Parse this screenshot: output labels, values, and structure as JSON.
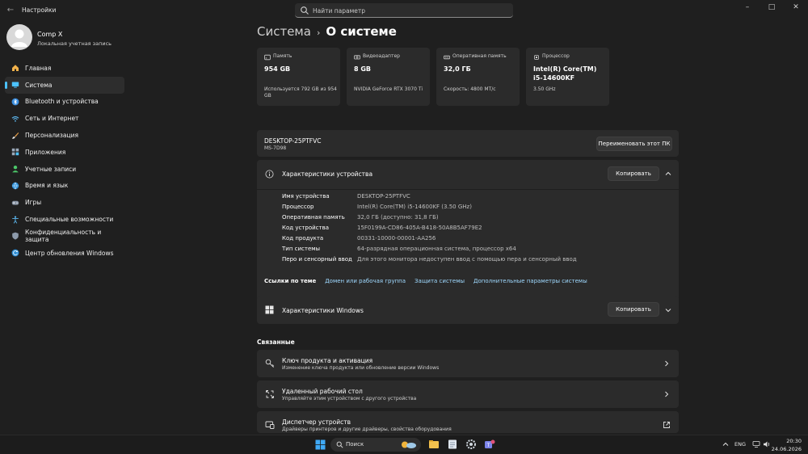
{
  "window": {
    "title": "Настройки",
    "search_placeholder": "Найти параметр",
    "minimize": "–",
    "maximize": "□",
    "close": "✕",
    "back": "←"
  },
  "profile": {
    "name": "Comp X",
    "subtitle": "Локальная учетная запись"
  },
  "sidebar": {
    "items": [
      {
        "label": "Главная",
        "icon": "home-icon"
      },
      {
        "label": "Система",
        "icon": "system-icon"
      },
      {
        "label": "Bluetooth и устройства",
        "icon": "bluetooth-icon"
      },
      {
        "label": "Сеть и Интернет",
        "icon": "wifi-icon"
      },
      {
        "label": "Персонализация",
        "icon": "brush-icon"
      },
      {
        "label": "Приложения",
        "icon": "apps-icon"
      },
      {
        "label": "Учетные записи",
        "icon": "accounts-icon"
      },
      {
        "label": "Время и язык",
        "icon": "globe-icon"
      },
      {
        "label": "Игры",
        "icon": "gamepad-icon"
      },
      {
        "label": "Специальные возможности",
        "icon": "accessibility-icon"
      },
      {
        "label": "Конфиденциальность и защита",
        "icon": "shield-icon"
      },
      {
        "label": "Центр обновления Windows",
        "icon": "update-icon"
      }
    ]
  },
  "breadcrumb": {
    "parent": "Система",
    "separator": "›",
    "current": "О системе"
  },
  "cards": [
    {
      "label": "Память",
      "value": "954 GB",
      "detail": "Используется 792 GB из 954 GB",
      "icon": "storage-icon"
    },
    {
      "label": "Видеоадаптер",
      "value": "8 GB",
      "detail": "NVIDIA GeForce RTX 3070 Ti",
      "icon": "gpu-icon"
    },
    {
      "label": "Оперативная память",
      "value": "32,0 ГБ",
      "detail": "Скорость: 4800 МТ/с",
      "icon": "ram-icon"
    },
    {
      "label": "Процессор",
      "value": "Intel(R) Core(TM) i5-14600KF",
      "detail": "3.50 GHz",
      "icon": "cpu-icon"
    }
  ],
  "device": {
    "name": "DESKTOP-25PTFVC",
    "model": "MS-7D98",
    "rename_label": "Переименовать этот ПК"
  },
  "device_specs": {
    "title": "Характеристики устройства",
    "copy_label": "Копировать",
    "rows": [
      {
        "label": "Имя устройства",
        "value": "DESKTOP-25PTFVC"
      },
      {
        "label": "Процессор",
        "value": "Intel(R) Core(TM) i5-14600KF (3.50 GHz)"
      },
      {
        "label": "Оперативная память",
        "value": "32,0 ГБ (доступно: 31,8 ГБ)"
      },
      {
        "label": "Код устройства",
        "value": "15F0199A-CD86-405A-B418-50A8B5AF79E2"
      },
      {
        "label": "Код продукта",
        "value": "00331-10000-00001-AA256"
      },
      {
        "label": "Тип системы",
        "value": "64-разрядная операционная система, процессор x64"
      },
      {
        "label": "Перо и сенсорный ввод",
        "value": "Для этого монитора недоступен ввод с помощью пера и сенсорный ввод"
      }
    ],
    "links_label": "Ссылки по теме",
    "links": [
      "Домен или рабочая группа",
      "Защита системы",
      "Дополнительные параметры системы"
    ]
  },
  "windows_specs": {
    "title": "Характеристики Windows",
    "copy_label": "Копировать"
  },
  "related": {
    "title": "Связанные",
    "items": [
      {
        "title": "Ключ продукта и активация",
        "subtitle": "Изменение ключа продукта или обновление версии Windows",
        "icon": "key-icon",
        "arrow": "chevron-right-icon"
      },
      {
        "title": "Удаленный рабочий стол",
        "subtitle": "Управляйте этим устройством с другого устройства",
        "icon": "remote-desktop-icon",
        "arrow": "chevron-right-icon"
      },
      {
        "title": "Диспетчер устройств",
        "subtitle": "Драйверы принтеров и другие драйверы, свойства оборудования",
        "icon": "device-manager-icon",
        "arrow": "external-link-icon"
      }
    ]
  },
  "taskbar": {
    "search_label": "Поиск",
    "language": "ENG",
    "time": "20:30",
    "date": "24.06.2026"
  },
  "colors": {
    "accent": "#4cc2ff",
    "link": "#9fd9ff",
    "background": "#1f1f1f",
    "panel": "#2b2b2b"
  }
}
